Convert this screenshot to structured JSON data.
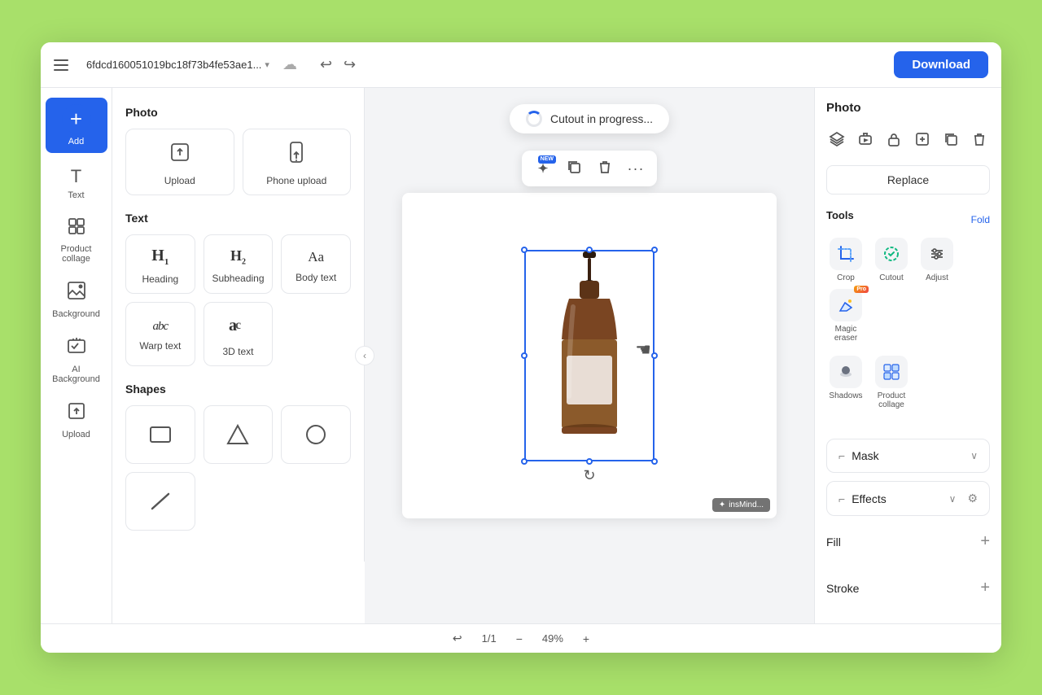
{
  "header": {
    "menu_label": "menu",
    "title": "6fdcd160051019bc18f73b4fe53ae1...",
    "title_chevron": "▾",
    "cloud_icon": "☁",
    "undo_icon": "↩",
    "redo_icon": "↪",
    "download_label": "Download"
  },
  "icon_sidebar": {
    "add_label": "Add",
    "text_label": "Text",
    "product_collage_label": "Product collage",
    "background_label": "Background",
    "ai_background_label": "AI Background",
    "upload_label": "Upload"
  },
  "panel": {
    "photo_section": "Photo",
    "upload_label": "Upload",
    "phone_upload_label": "Phone upload",
    "text_section": "Text",
    "heading_label": "Heading",
    "subheading_label": "Subheading",
    "body_text_label": "Body text",
    "warp_text_label": "Warp text",
    "three_d_text_label": "3D text",
    "shapes_section": "Shapes"
  },
  "canvas": {
    "cutout_toast": "Cutout in progress...",
    "insmind_badge": "insMind..."
  },
  "toolbar": {
    "ai_icon": "✦",
    "ai_badge": "NEW",
    "copy_icon": "⧉",
    "delete_icon": "🗑",
    "more_icon": "···"
  },
  "right_panel": {
    "title": "Photo",
    "replace_label": "Replace",
    "tools_title": "Tools",
    "fold_label": "Fold",
    "crop_label": "Crop",
    "cutout_label": "Cutout",
    "adjust_label": "Adjust",
    "magic_eraser_label": "Magic eraser",
    "shadows_label": "Shadows",
    "product_collage_label": "Product collage",
    "mask_label": "Mask",
    "effects_label": "Effects",
    "fill_label": "Fill",
    "stroke_label": "Stroke"
  },
  "bottom_bar": {
    "undo_icon": "↩",
    "page": "1/1",
    "zoom": "49%",
    "zoom_out": "−",
    "zoom_in": "+"
  },
  "colors": {
    "accent": "#2563eb",
    "border": "#e5e7eb",
    "bg_light": "#f3f4f6"
  }
}
